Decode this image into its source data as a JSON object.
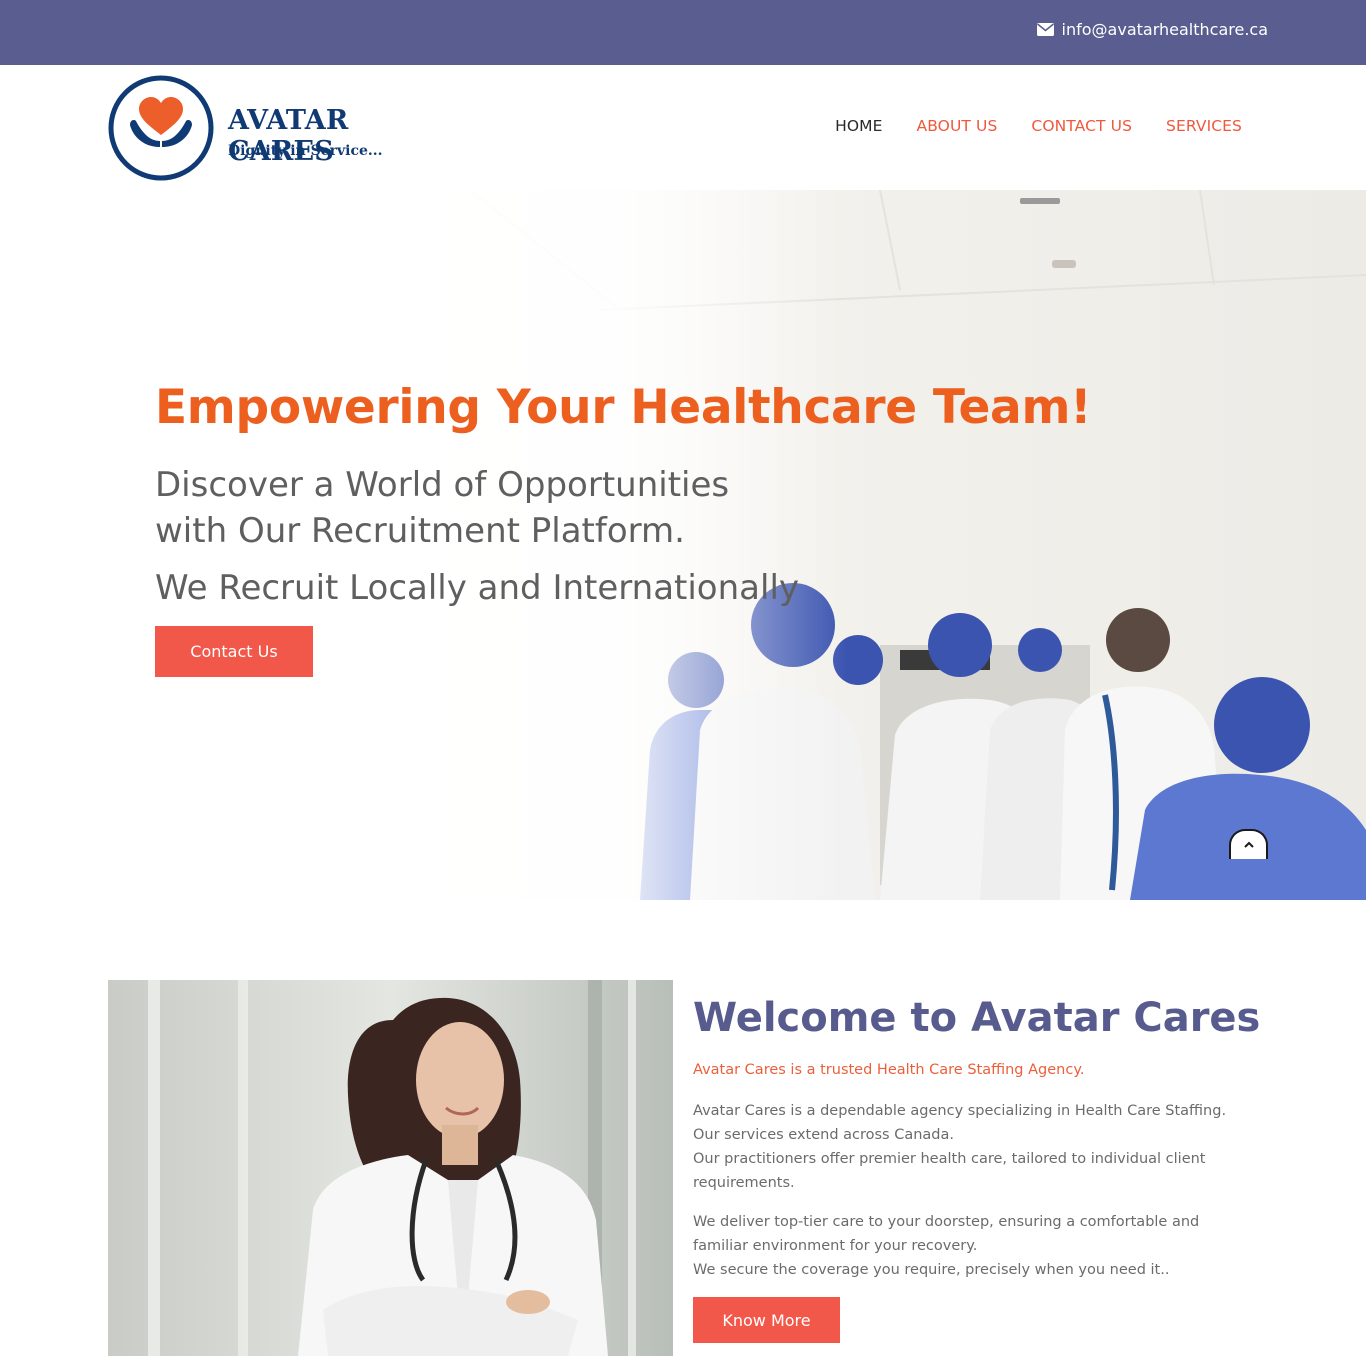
{
  "topbar": {
    "email": "info@avatarhealthcare.ca",
    "icon": "envelope-icon",
    "background": "#5a5d8f"
  },
  "brand": {
    "name": "AVATAR CARES",
    "tagline": "Dignity in Service...",
    "color": "#0f3a73",
    "accent": "#ec5f1e"
  },
  "nav": {
    "items": [
      {
        "label": "HOME",
        "active": true
      },
      {
        "label": "ABOUT US",
        "active": false
      },
      {
        "label": "CONTACT US",
        "active": false
      },
      {
        "label": "SERVICES",
        "active": false
      }
    ]
  },
  "hero": {
    "title": "Empowering Your Healthcare Team!",
    "subtitle_line1": "Discover a World of Opportunities",
    "subtitle_line2": "with Our Recruitment Platform.",
    "subtitle2": "We Recruit Locally and Internationally",
    "button_label": "Contact Us",
    "scroll_top_icon": "chevron-up-icon"
  },
  "welcome": {
    "title": "Welcome to Avatar Cares",
    "tagline": "Avatar Cares is a trusted Health Care Staffing Agency.",
    "para1_lines": [
      "Avatar Cares is a dependable agency specializing in Health Care Staffing.",
      "Our services extend across Canada.",
      "Our practitioners offer premier health care, tailored to individual client",
      "requirements."
    ],
    "para2_lines": [
      "We deliver top-tier care to your doorstep, ensuring a comfortable and",
      "familiar environment for your recovery.",
      "We secure the coverage you require, precisely when you need it.."
    ],
    "button_label": "Know More"
  },
  "colors": {
    "primary_button": "#f2584a",
    "heading_purple": "#575b8e",
    "hero_orange": "#ec5f1e"
  }
}
